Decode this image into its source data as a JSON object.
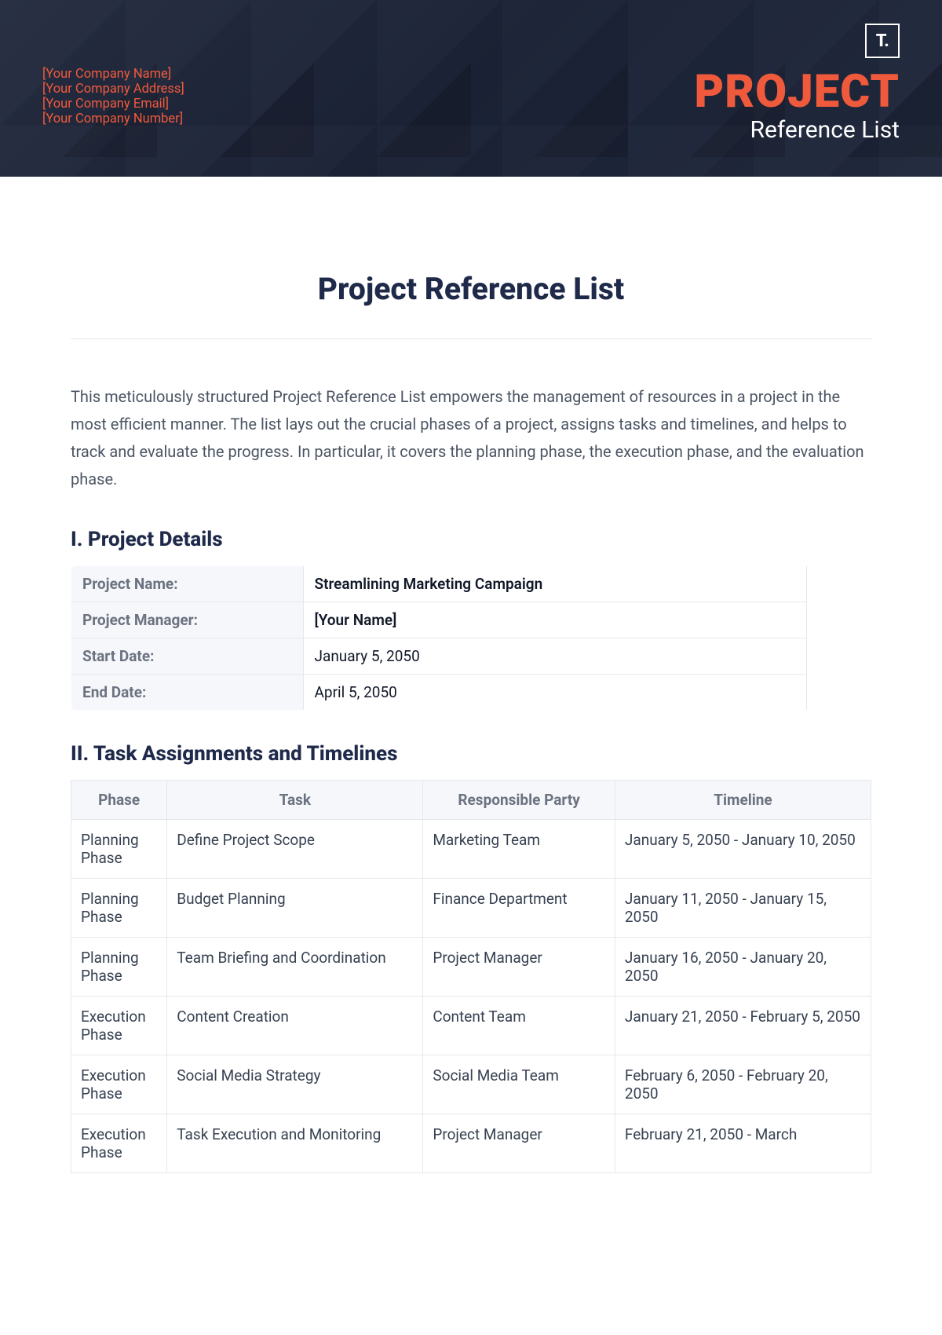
{
  "header": {
    "company_name": "[Your Company Name]",
    "company_address": "[Your Company Address]",
    "company_email": "[Your Company Email]",
    "company_number": "[Your Company Number]",
    "logo_text": "T.",
    "title": "PROJECT",
    "subtitle": "Reference List"
  },
  "doc": {
    "title": "Project Reference List",
    "intro": "This meticulously structured Project Reference List empowers the management of resources in a project in the most efficient manner. The list lays out the crucial phases of a project, assigns tasks and timelines, and helps to track and evaluate the progress. In particular, it covers the planning phase, the execution phase, and the evaluation phase."
  },
  "section1": {
    "heading": "I. Project Details",
    "labels": {
      "project_name": "Project Name:",
      "project_manager": "Project Manager:",
      "start_date": "Start Date:",
      "end_date": "End Date:"
    },
    "values": {
      "project_name": "Streamlining Marketing Campaign",
      "project_manager": "[Your Name]",
      "start_date": "January 5, 2050",
      "end_date": "April 5, 2050"
    }
  },
  "section2": {
    "heading": "II. Task Assignments and Timelines",
    "columns": {
      "phase": "Phase",
      "task": "Task",
      "party": "Responsible Party",
      "timeline": "Timeline"
    },
    "rows": [
      {
        "phase": "Planning Phase",
        "task": "Define Project Scope",
        "party": "Marketing Team",
        "timeline": "January 5, 2050 - January 10, 2050"
      },
      {
        "phase": "Planning Phase",
        "task": "Budget Planning",
        "party": "Finance Department",
        "timeline": "January 11, 2050 - January 15, 2050"
      },
      {
        "phase": "Planning Phase",
        "task": "Team Briefing and Coordination",
        "party": "Project Manager",
        "timeline": "January 16, 2050 - January 20, 2050"
      },
      {
        "phase": "Execution Phase",
        "task": "Content Creation",
        "party": "Content Team",
        "timeline": "January 21, 2050 - February 5, 2050"
      },
      {
        "phase": "Execution Phase",
        "task": "Social Media Strategy",
        "party": "Social Media Team",
        "timeline": "February 6, 2050 - February 20, 2050"
      },
      {
        "phase": "Execution Phase",
        "task": "Task Execution and Monitoring",
        "party": "Project Manager",
        "timeline": "February 21, 2050 - March"
      }
    ]
  }
}
